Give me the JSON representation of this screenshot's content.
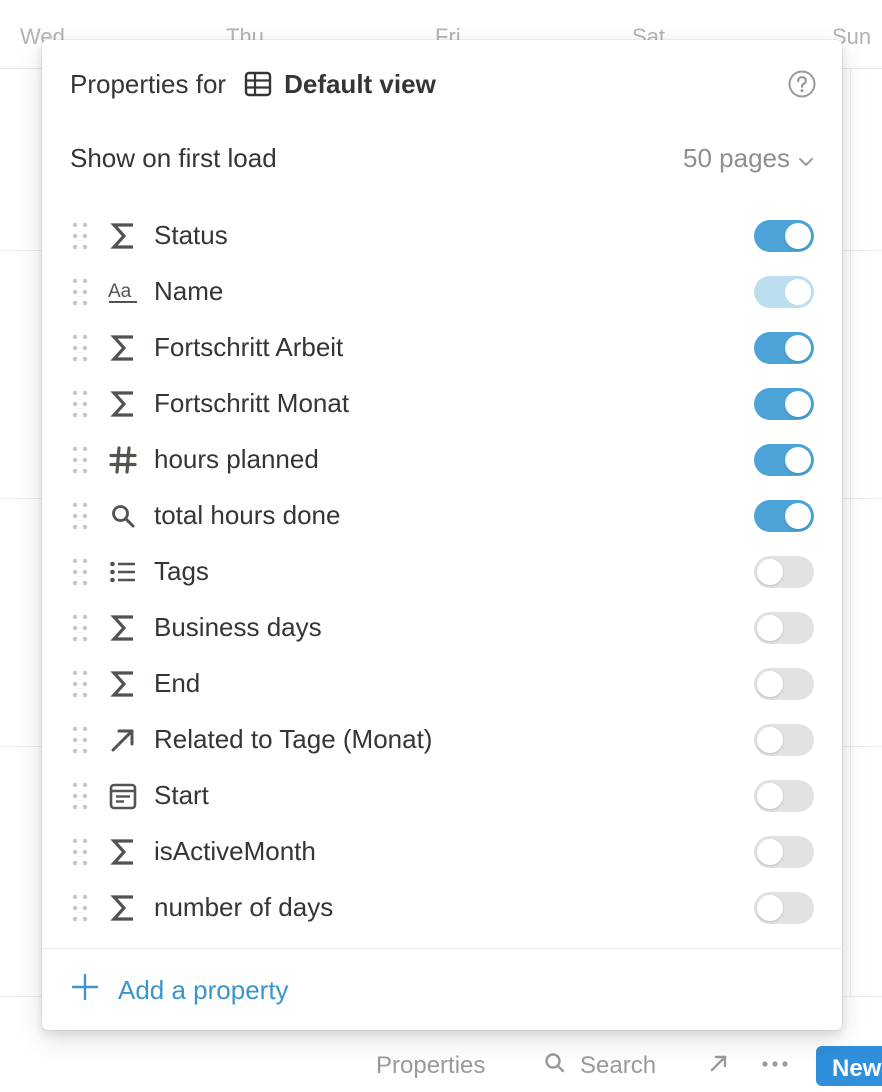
{
  "calendar": {
    "days": [
      "Wed",
      "Thu",
      "Fri",
      "Sat",
      "Sun"
    ]
  },
  "bottom_bar": {
    "properties_label": "Properties",
    "search_label": "Search",
    "new_label": "New"
  },
  "popover": {
    "title_prefix": "Properties for",
    "view_name": "Default view",
    "first_load_label": "Show on first load",
    "first_load_value": "50 pages",
    "add_property_label": "Add a property",
    "accent_color": "#4da3d8",
    "properties": [
      {
        "label": "Status",
        "icon": "formula-sigma-icon",
        "visible": true
      },
      {
        "label": "Name",
        "icon": "text-aa-icon",
        "visible": true,
        "locked": true
      },
      {
        "label": "Fortschritt Arbeit",
        "icon": "formula-sigma-icon",
        "visible": true
      },
      {
        "label": "Fortschritt Monat",
        "icon": "formula-sigma-icon",
        "visible": true
      },
      {
        "label": "hours planned",
        "icon": "number-hash-icon",
        "visible": true
      },
      {
        "label": "total hours done",
        "icon": "rollup-search-icon",
        "visible": true
      },
      {
        "label": "Tags",
        "icon": "multi-select-list-icon",
        "visible": false
      },
      {
        "label": "Business days",
        "icon": "formula-sigma-icon",
        "visible": false
      },
      {
        "label": "End",
        "icon": "formula-sigma-icon",
        "visible": false
      },
      {
        "label": "Related to Tage (Monat)",
        "icon": "relation-arrow-icon",
        "visible": false
      },
      {
        "label": "Start",
        "icon": "date-calendar-icon",
        "visible": false
      },
      {
        "label": "isActiveMonth",
        "icon": "formula-sigma-icon",
        "visible": false
      },
      {
        "label": "number of days",
        "icon": "formula-sigma-icon",
        "visible": false
      }
    ]
  }
}
